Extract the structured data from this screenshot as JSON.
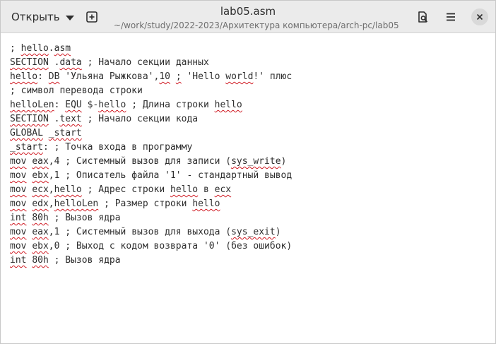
{
  "header": {
    "open_label": "Открыть",
    "title": "lab05.asm",
    "subtitle": "~/work/study/2022-2023/Архитектура компьютера/arch-pc/lab05"
  },
  "editor": {
    "lines": [
      [
        {
          "t": "; "
        },
        {
          "t": "hello",
          "sq": true
        },
        {
          "t": "."
        },
        {
          "t": "asm",
          "sq": true
        }
      ],
      [
        {
          "t": "SECTION",
          "sq": true
        },
        {
          "t": " ."
        },
        {
          "t": "data",
          "sq": true
        },
        {
          "t": " ; Начало секции данных"
        }
      ],
      [
        {
          "t": "hello",
          "sq": true
        },
        {
          "t": ": "
        },
        {
          "t": "DB",
          "sq": true
        },
        {
          "t": " 'Ульяна Рыжкова',"
        },
        {
          "t": "10",
          "sq": true
        },
        {
          "t": " "
        },
        {
          "t": ";",
          "sq": true
        },
        {
          "t": " 'Hello "
        },
        {
          "t": "world",
          "sq": true
        },
        {
          "t": "!' плюс"
        }
      ],
      [
        {
          "t": "; символ перевода строки"
        }
      ],
      [
        {
          "t": "helloLen",
          "sq": true
        },
        {
          "t": ": "
        },
        {
          "t": "EQU",
          "sq": true
        },
        {
          "t": " $-"
        },
        {
          "t": "hello",
          "sq": true
        },
        {
          "t": " ; Длина строки "
        },
        {
          "t": "hello",
          "sq": true
        }
      ],
      [
        {
          "t": "SECTION",
          "sq": true
        },
        {
          "t": " ."
        },
        {
          "t": "text",
          "sq": true
        },
        {
          "t": " ; Начало секции кода"
        }
      ],
      [
        {
          "t": "GLOBAL",
          "sq": true
        },
        {
          "t": " "
        },
        {
          "t": "_start",
          "sq": true
        }
      ],
      [
        {
          "t": "_start",
          "sq": true
        },
        {
          "t": ": ; Точка входа в программу"
        }
      ],
      [
        {
          "t": "mov",
          "sq": true
        },
        {
          "t": " "
        },
        {
          "t": "eax",
          "sq": true
        },
        {
          "t": ",4 ; Системный вызов для записи ("
        },
        {
          "t": "sys_write",
          "sq": true
        },
        {
          "t": ")"
        }
      ],
      [
        {
          "t": "mov",
          "sq": true
        },
        {
          "t": " "
        },
        {
          "t": "ebx",
          "sq": true
        },
        {
          "t": ",1 ; Описатель файла '1' - стандартный вывод"
        }
      ],
      [
        {
          "t": "mov",
          "sq": true
        },
        {
          "t": " "
        },
        {
          "t": "ecx",
          "sq": true
        },
        {
          "t": ","
        },
        {
          "t": "hello",
          "sq": true
        },
        {
          "t": " ; Адрес строки "
        },
        {
          "t": "hello",
          "sq": true
        },
        {
          "t": " в "
        },
        {
          "t": "ecx",
          "sq": true
        }
      ],
      [
        {
          "t": "mov",
          "sq": true
        },
        {
          "t": " "
        },
        {
          "t": "edx",
          "sq": true
        },
        {
          "t": ","
        },
        {
          "t": "helloLen",
          "sq": true
        },
        {
          "t": " ; Размер строки "
        },
        {
          "t": "hello",
          "sq": true
        }
      ],
      [
        {
          "t": "int",
          "sq": true
        },
        {
          "t": " "
        },
        {
          "t": "80h",
          "sq": true
        },
        {
          "t": " ; Вызов ядра"
        }
      ],
      [
        {
          "t": "mov",
          "sq": true
        },
        {
          "t": " "
        },
        {
          "t": "eax",
          "sq": true
        },
        {
          "t": ",1 ; Системный вызов для выхода ("
        },
        {
          "t": "sys_exit",
          "sq": true
        },
        {
          "t": ")"
        }
      ],
      [
        {
          "t": "mov",
          "sq": true
        },
        {
          "t": " "
        },
        {
          "t": "ebx",
          "sq": true
        },
        {
          "t": ",0 ; Выход с кодом возврата '0' (без ошибок)"
        }
      ],
      [
        {
          "t": "int",
          "sq": true
        },
        {
          "t": " "
        },
        {
          "t": "80h",
          "sq": true
        },
        {
          "t": " ; Вызов ядра"
        }
      ]
    ]
  },
  "icons": {
    "new_tab": "new-tab-icon",
    "search": "search-document-icon",
    "menu": "hamburger-menu-icon",
    "close": "close-icon"
  },
  "colors": {
    "header_bg": "#ebebeb",
    "text": "#2e2e2e",
    "spell_underline": "#d01b24"
  }
}
